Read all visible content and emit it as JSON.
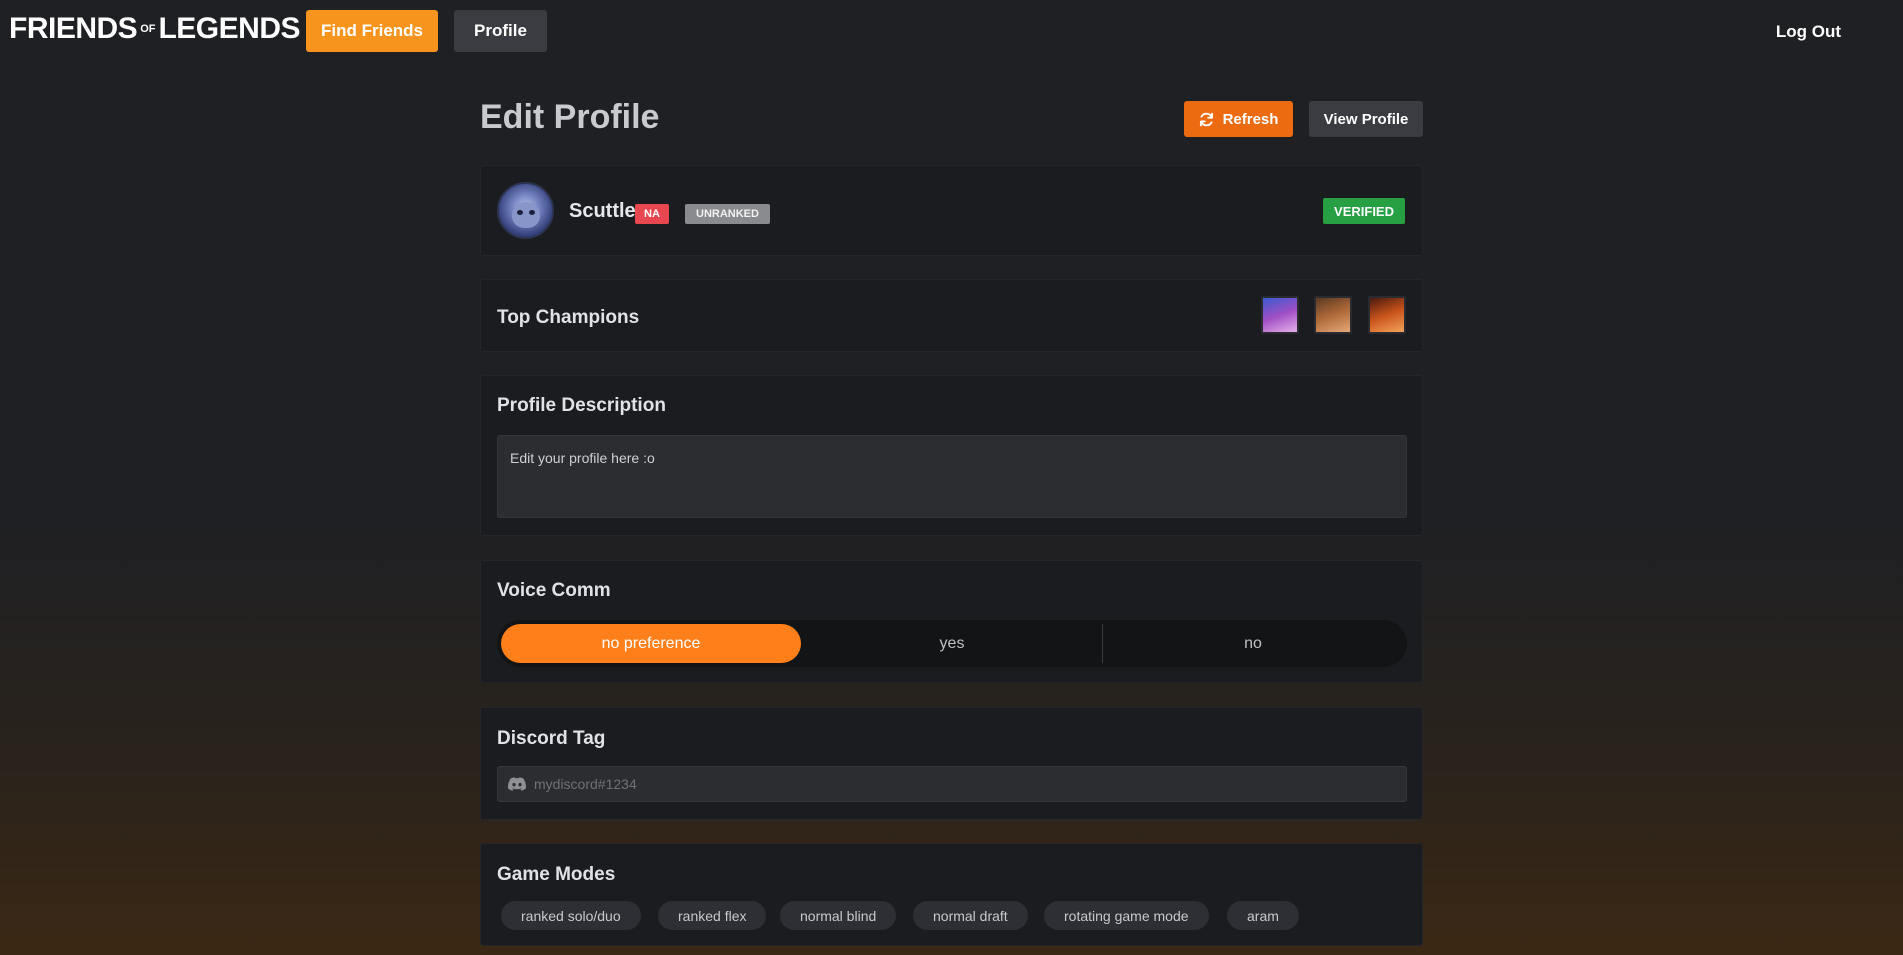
{
  "nav": {
    "logo_part1": "FRIENDS",
    "logo_of": "OF",
    "logo_part2": "LEGENDS",
    "find_friends": "Find Friends",
    "profile": "Profile",
    "logout": "Log Out"
  },
  "header": {
    "title": "Edit Profile",
    "refresh": "Refresh",
    "view_profile": "View Profile"
  },
  "profile": {
    "username": "Scuttle",
    "region": "NA",
    "rank": "UNRANKED",
    "status": "VERIFIED"
  },
  "champions": {
    "title": "Top Champions",
    "icons": [
      "champion-portrait-1",
      "champion-portrait-2",
      "champion-portrait-3"
    ]
  },
  "description": {
    "title": "Profile Description",
    "value": "Edit your profile here :o"
  },
  "voice": {
    "title": "Voice Comm",
    "options": [
      "no preference",
      "yes",
      "no"
    ],
    "selected": "no preference"
  },
  "discord": {
    "title": "Discord Tag",
    "placeholder": "mydiscord#1234",
    "value": ""
  },
  "game_modes": {
    "title": "Game Modes",
    "modes": [
      "ranked solo/duo",
      "ranked flex",
      "normal blind",
      "normal draft",
      "rotating game mode",
      "aram"
    ]
  },
  "colors": {
    "accent": "#f7941d",
    "refresh": "#ec6a10",
    "active_segment": "#ff7f1a",
    "region_badge": "#e9474f",
    "rank_badge": "#8a8b8e",
    "verified_badge": "#26a043"
  }
}
